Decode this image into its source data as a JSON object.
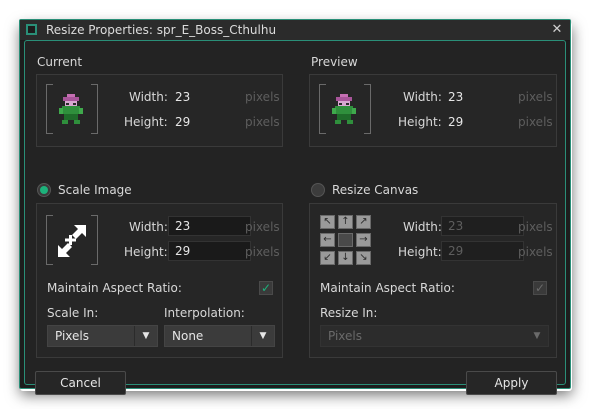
{
  "window": {
    "title": "Resize Properties: spr_E_Boss_Cthulhu",
    "close_glyph": "✕"
  },
  "current": {
    "heading": "Current",
    "width_label": "Width:",
    "width_value": "23",
    "height_label": "Height:",
    "height_value": "29",
    "unit": "pixels"
  },
  "preview": {
    "heading": "Preview",
    "width_label": "Width:",
    "width_value": "23",
    "height_label": "Height:",
    "height_value": "29",
    "unit": "pixels"
  },
  "scale": {
    "radio_label": "Scale Image",
    "selected": true,
    "width_label": "Width:",
    "width_value": "23",
    "height_label": "Height:",
    "height_value": "29",
    "unit": "pixels",
    "aspect_label": "Maintain Aspect Ratio:",
    "aspect_checked": true,
    "scale_in_label": "Scale In:",
    "scale_in_value": "Pixels",
    "interp_label": "Interpolation:",
    "interp_value": "None"
  },
  "canvas": {
    "radio_label": "Resize Canvas",
    "selected": false,
    "width_label": "Width:",
    "width_value": "23",
    "height_label": "Height:",
    "height_value": "29",
    "unit": "pixels",
    "aspect_label": "Maintain Aspect Ratio:",
    "aspect_checked": true,
    "resize_in_label": "Resize In:",
    "resize_in_value": "Pixels"
  },
  "buttons": {
    "cancel": "Cancel",
    "apply": "Apply"
  },
  "colors": {
    "accent": "#2a8f78",
    "radio_on": "#1db27b",
    "check": "#1db27b"
  }
}
